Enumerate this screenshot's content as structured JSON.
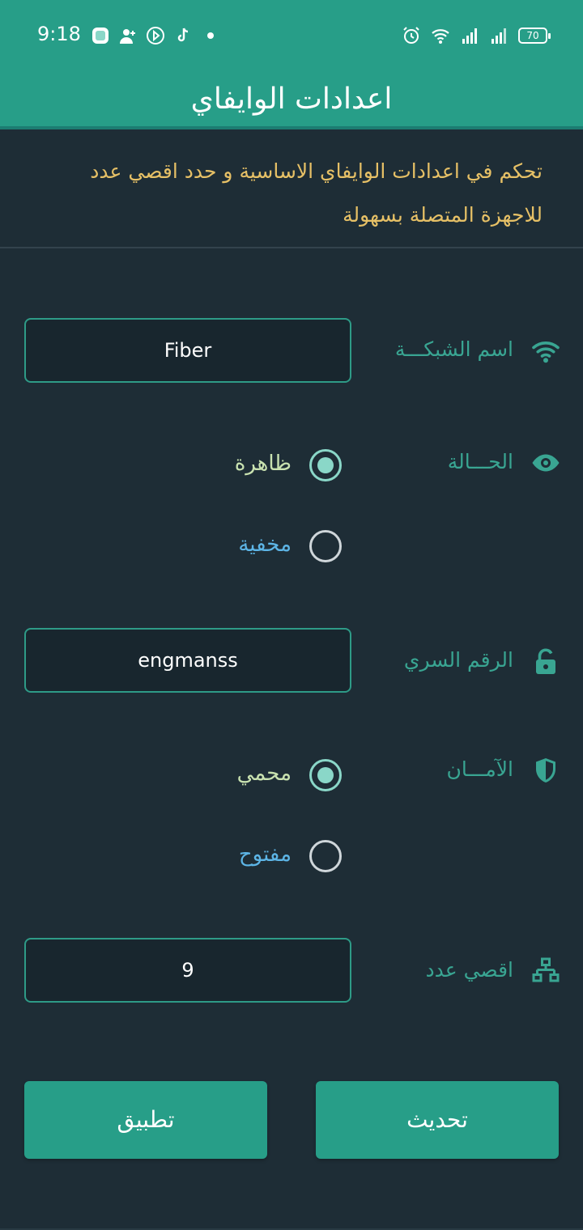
{
  "status_bar": {
    "time": "9:18",
    "battery": "70",
    "icons_left": [
      "notification-app-icon",
      "person-add-icon",
      "play-circle-icon",
      "tiktok-icon",
      "dot-icon"
    ],
    "icons_right": [
      "alarm-icon",
      "wifi-icon",
      "signal-icon",
      "signal-icon",
      "battery-icon"
    ]
  },
  "app_bar": {
    "title": "اعدادات الوايفاي"
  },
  "intro": {
    "text": "تحكم في اعدادات الوايفاي الاساسية و حدد اقصي عدد للاجهزة المتصلة بسهولة"
  },
  "form": {
    "network_name": {
      "label": "اسم الشبكـــة",
      "value": "Fiber",
      "icon": "wifi-icon"
    },
    "visibility": {
      "label": "الحـــالة",
      "icon": "eye-icon",
      "options": [
        {
          "label": "ظاهرة",
          "selected": true
        },
        {
          "label": "مخفية",
          "selected": false
        }
      ]
    },
    "password": {
      "label": "الرقم السري",
      "value": "engmanss",
      "icon": "unlock-icon"
    },
    "security": {
      "label": "الآمـــان",
      "icon": "shield-icon",
      "options": [
        {
          "label": "محمي",
          "selected": true
        },
        {
          "label": "مفتوح",
          "selected": false
        }
      ]
    },
    "max_devices": {
      "label": "اقصي عدد",
      "value": "9",
      "icon": "network-icon"
    }
  },
  "buttons": {
    "apply": "تطبيق",
    "refresh": "تحديث"
  },
  "colors": {
    "primary": "#279e88",
    "background": "#1e2d36",
    "intro_text": "#e6c066",
    "label_text": "#39a592"
  }
}
